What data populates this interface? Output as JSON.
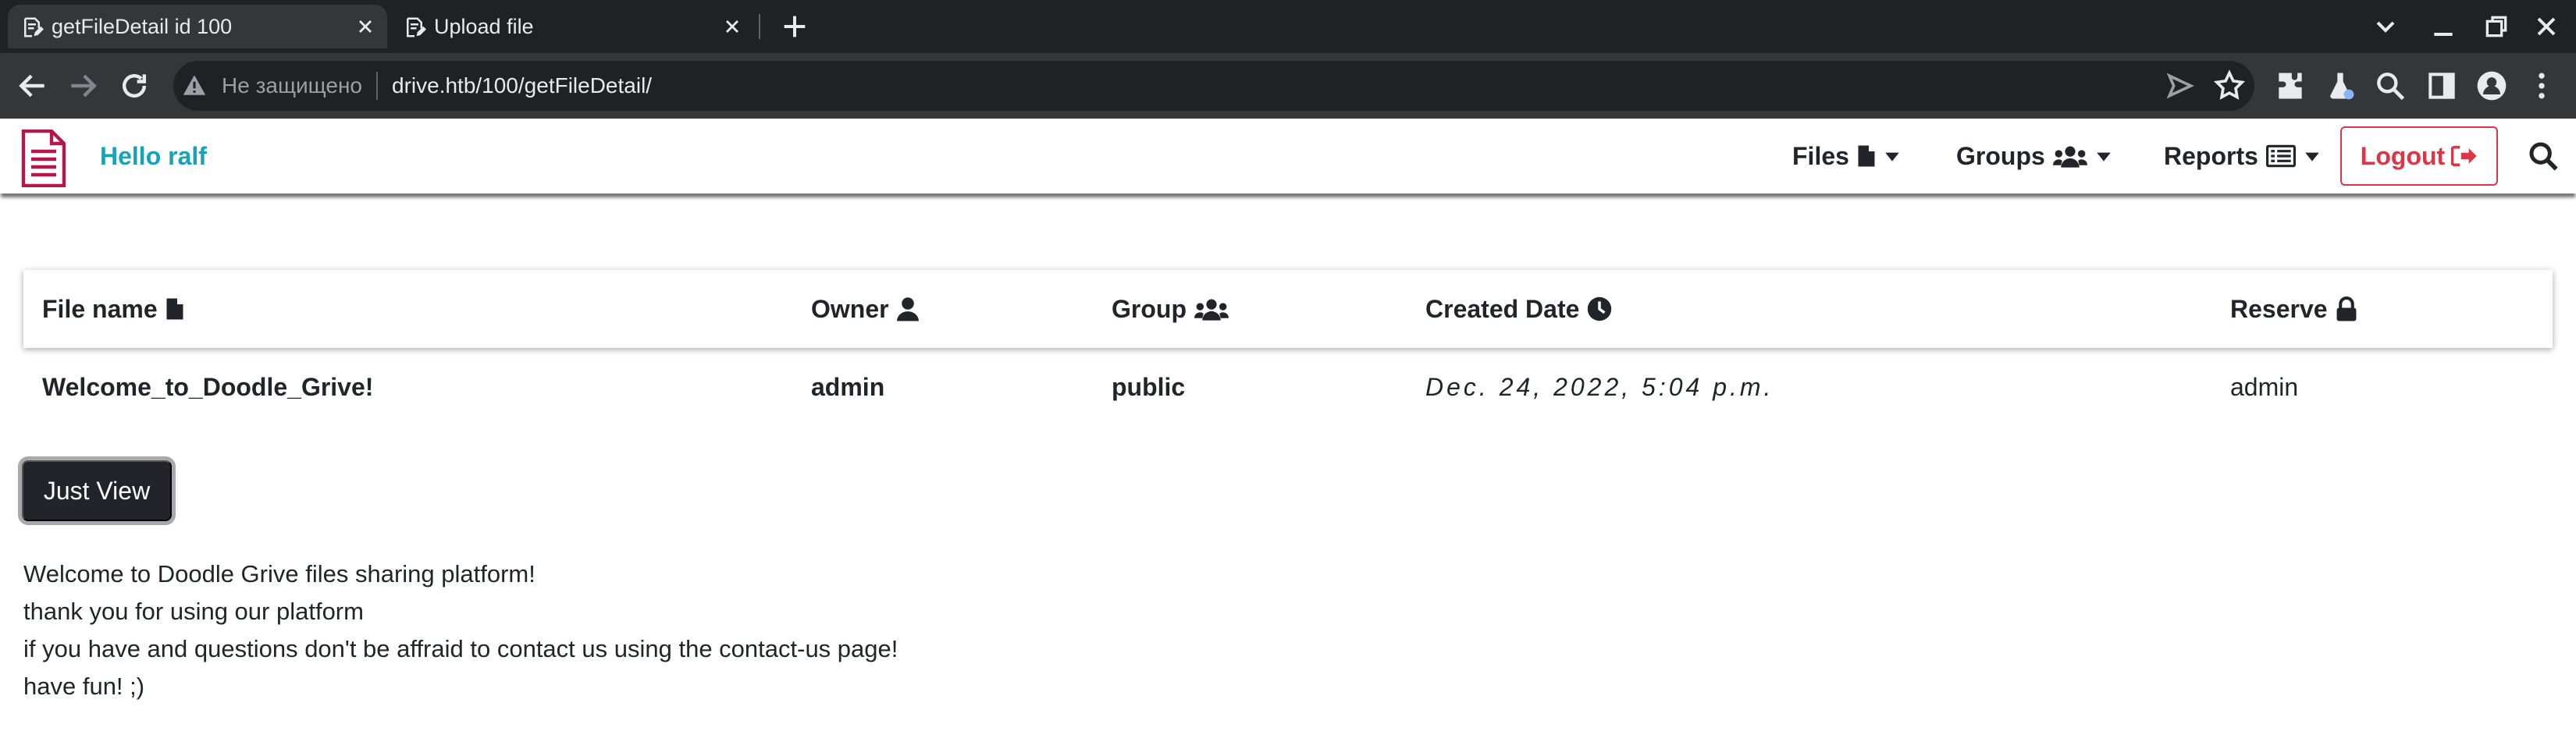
{
  "browser": {
    "tabs": [
      {
        "title": "getFileDetail id 100",
        "active": true
      },
      {
        "title": "Upload file",
        "active": false
      }
    ],
    "address_bar": {
      "security_label": "Не защищено",
      "url": "drive.htb/100/getFileDetail/"
    }
  },
  "navbar": {
    "greeting": "Hello ralf",
    "menus": {
      "files": "Files",
      "groups": "Groups",
      "reports": "Reports"
    },
    "logout_label": "Logout",
    "brand_color": "#b5174a",
    "greeting_color": "#17a2b8",
    "logout_color": "#dc3545"
  },
  "table": {
    "headers": {
      "file_name": "File name",
      "owner": "Owner",
      "group": "Group",
      "created_date": "Created Date",
      "reserve": "Reserve"
    },
    "row": {
      "file_name": "Welcome_to_Doodle_Grive!",
      "owner": "admin",
      "group": "public",
      "created_date": "Dec. 24, 2022, 5:04 p.m.",
      "reserve": "admin"
    }
  },
  "view_button_label": "Just View",
  "content_lines": [
    "Welcome to Doodle Grive files sharing platform!",
    "thank you for using our platform",
    "if you have and questions don't be affraid to contact us using the contact-us page!",
    "have fun! ;)"
  ],
  "icons": {
    "tab_icon": "document-edit-icon",
    "brand": "document-icon",
    "files": "file-icon",
    "groups": "users-icon",
    "reports": "list-icon",
    "logout": "sign-out-icon",
    "search": "search-icon",
    "owner": "user-icon",
    "created": "clock-icon",
    "reserve": "lock-icon"
  }
}
